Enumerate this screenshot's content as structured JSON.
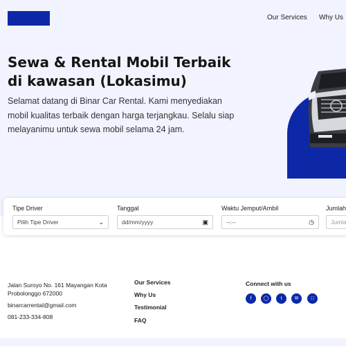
{
  "header": {
    "nav": [
      {
        "label": "Our Services"
      },
      {
        "label": "Why Us"
      }
    ]
  },
  "hero": {
    "title": "Sewa & Rental Mobil Terbaik di kawasan (Lokasimu)",
    "description": "Selamat datang di Binar Car Rental. Kami menyediakan mobil kualitas terbaik dengan harga terjangkau. Selalu siap melayanimu untuk sewa mobil selama 24 jam."
  },
  "search": {
    "fields": [
      {
        "label": "Tipe Driver",
        "value": "Pilih Tipe Driver",
        "icon": "chevron-down-icon"
      },
      {
        "label": "Tanggal",
        "value": "dd/mm/yyyy",
        "icon": "calendar-icon"
      },
      {
        "label": "Waktu Jemput/Ambil",
        "value": "--:--",
        "icon": "clock-icon"
      },
      {
        "label": "Jumlah",
        "value": "Jumla"
      }
    ]
  },
  "footer": {
    "address": "Jalan Suroyo No. 161 Mayangan Kota Probolonggo 672000",
    "email": "binarcarrental@gmail.com",
    "phone": "081-233-334-808",
    "links": [
      {
        "label": "Our Services"
      },
      {
        "label": "Why Us"
      },
      {
        "label": "Testimonial"
      },
      {
        "label": "FAQ"
      }
    ],
    "connect_title": "Connect with us",
    "social_icons": [
      "facebook-icon",
      "instagram-icon",
      "twitter-icon",
      "mail-icon",
      "twitch-icon"
    ]
  },
  "colors": {
    "accent": "#0d28a6",
    "hero_bg": "#f1f3ff"
  }
}
